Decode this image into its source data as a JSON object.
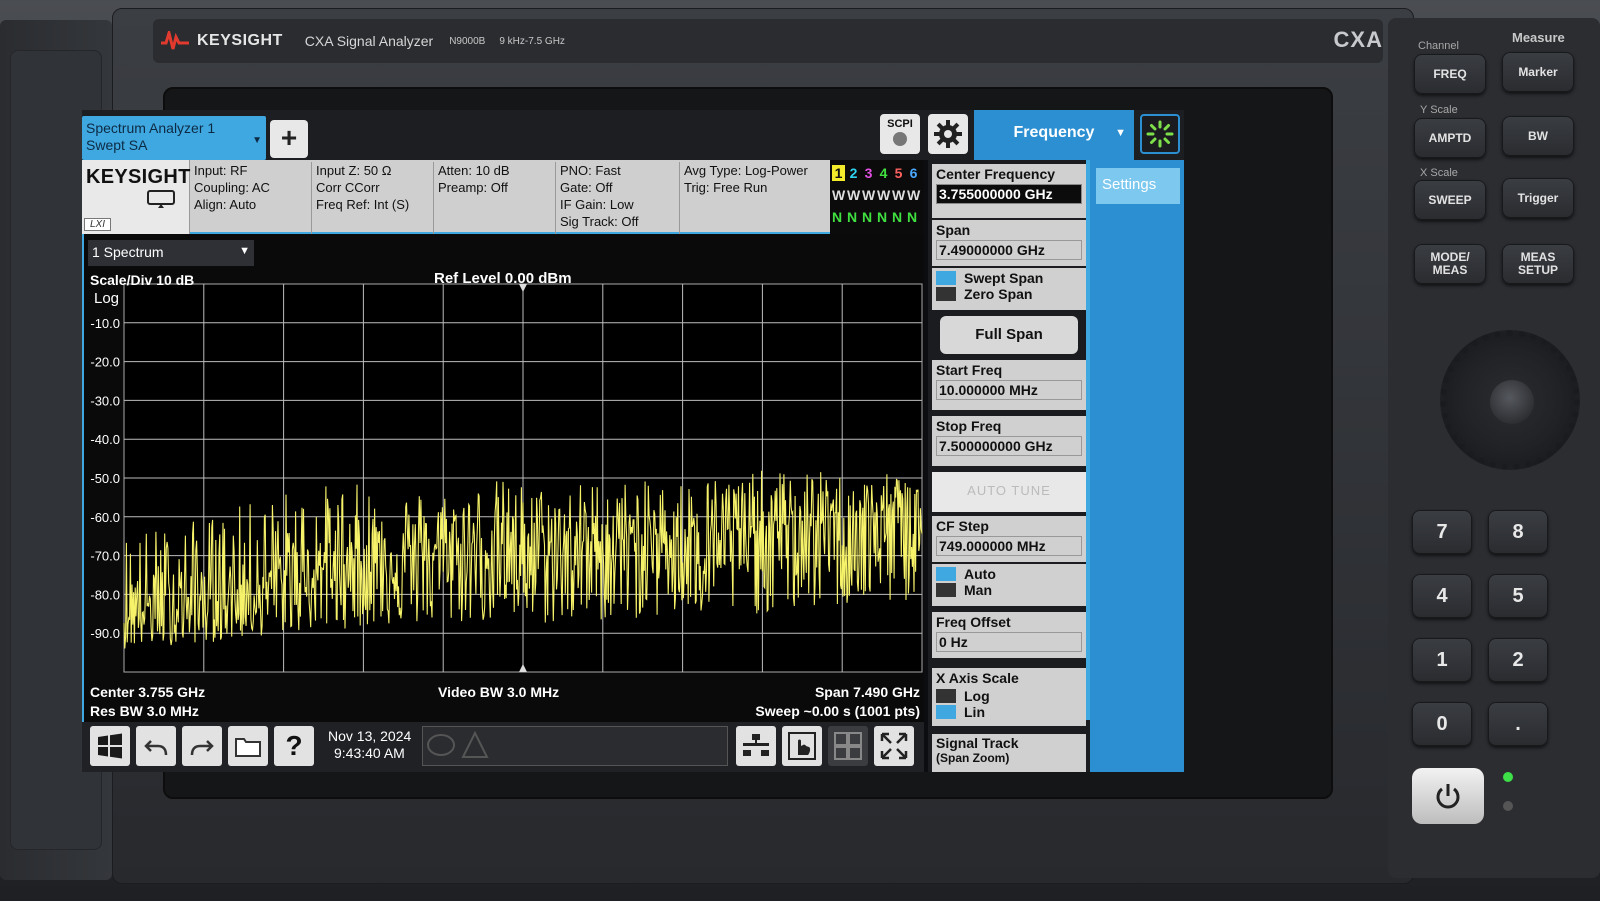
{
  "chassis": {
    "brand": "KEYSIGHT",
    "model_name": "CXA Signal Analyzer",
    "model_no": "N9000B",
    "range": "9 kHz-7.5 GHz",
    "badge": "CXA"
  },
  "topbar": {
    "mode_line1": "Spectrum Analyzer 1",
    "mode_line2": "Swept SA",
    "add_label": "+",
    "scpi_label": "SCPI",
    "menu_tab": "Frequency"
  },
  "infobar": {
    "logo": "KEYSIGHT",
    "lxi": "LXI",
    "col1": [
      "Input: RF",
      "Coupling: AC",
      "Align: Auto"
    ],
    "col2": [
      "Input Z: 50 Ω",
      "Corr CCorr",
      "Freq Ref: Int (S)"
    ],
    "col3": [
      "Atten: 10 dB",
      "Preamp: Off"
    ],
    "col4": [
      "PNO: Fast",
      "Gate: Off",
      "IF Gain: Low",
      "Sig Track: Off"
    ],
    "col5": [
      "Avg Type: Log-Power",
      "Trig: Free Run"
    ],
    "trace_numbers": [
      "1",
      "2",
      "3",
      "4",
      "5",
      "6"
    ],
    "trace_colors": [
      "#f4ec2a",
      "#2fd0f0",
      "#e050e0",
      "#40e040",
      "#ff6060",
      "#4aa8ff"
    ],
    "trace_types": [
      "W",
      "W",
      "W",
      "W",
      "W",
      "W"
    ],
    "trace_det": [
      "N",
      "N",
      "N",
      "N",
      "N",
      "N"
    ]
  },
  "graph": {
    "view": "1 Spectrum",
    "scale_div": "Scale/Div 10 dB",
    "scale_type": "Log",
    "ref_level": "Ref Level 0.00 dBm",
    "center": "Center 3.755 GHz",
    "res_bw": "Res BW 3.0 MHz",
    "video_bw": "Video BW 3.0 MHz",
    "span": "Span 7.490 GHz",
    "sweep": "Sweep ~0.00 s (1001 pts)"
  },
  "toolbar": {
    "date": "Nov 13, 2024",
    "time": "9:43:40 AM"
  },
  "menu": {
    "center_freq_label": "Center Frequency",
    "center_freq_value": "3.755000000 GHz",
    "span_label": "Span",
    "span_value": "7.49000000 GHz",
    "swept_span": "Swept Span",
    "zero_span": "Zero Span",
    "full_span": "Full Span",
    "start_freq_label": "Start Freq",
    "start_freq_value": "10.000000 MHz",
    "stop_freq_label": "Stop Freq",
    "stop_freq_value": "7.500000000 GHz",
    "auto_tune": "AUTO TUNE",
    "cf_step_label": "CF Step",
    "cf_step_value": "749.000000 MHz",
    "auto": "Auto",
    "man": "Man",
    "freq_offset_label": "Freq Offset",
    "freq_offset_value": "0 Hz",
    "x_axis_scale_label": "X Axis Scale",
    "log": "Log",
    "lin": "Lin",
    "signal_track_label": "Signal Track",
    "signal_track_sub": "(Span Zoom)",
    "settings_tab": "Settings"
  },
  "front_panel": {
    "channel_label": "Channel",
    "measure_label": "Measure",
    "y_scale_label": "Y Scale",
    "x_scale_label": "X Scale",
    "freq": "FREQ",
    "marker": "Marker",
    "amptd": "AMPTD",
    "bw": "BW",
    "sweep": "SWEEP",
    "trigger": "Trigger",
    "mode_meas": "MODE/ MEAS",
    "meas_setup": "MEAS SETUP",
    "keys": [
      "7",
      "8",
      "4",
      "5",
      "1",
      "2",
      "0",
      "."
    ]
  },
  "chart_data": {
    "type": "line",
    "ylabel": "Log",
    "ylim": [
      -100,
      0
    ],
    "y_ticks": [
      "-10.0",
      "-20.0",
      "-30.0",
      "-40.0",
      "-50.0",
      "-60.0",
      "-70.0",
      "-80.0",
      "-90.0"
    ],
    "x_range_ghz": [
      0.01,
      7.5
    ],
    "series": [
      {
        "trace_color": "#f6f26a",
        "x_ghz": [
          0.01,
          0.5,
          1.0,
          1.5,
          2.0,
          2.5,
          3.0,
          3.5,
          4.0,
          4.5,
          5.0,
          5.5,
          6.0,
          6.5,
          7.0,
          7.5
        ],
        "noise_floor_dbm": [
          -84,
          -82,
          -80,
          -76,
          -72,
          -70,
          -68,
          -67,
          -68,
          -66,
          -65,
          -64,
          -63,
          -61,
          -60,
          -58
        ],
        "peak_dbm": [
          -63,
          -62,
          -58,
          -53,
          -51,
          -52,
          -53,
          -50,
          -52,
          -50,
          -51,
          -49,
          -48,
          -48,
          -50,
          -47
        ],
        "trough_dbm": [
          -94,
          -93,
          -92,
          -90,
          -89,
          -88,
          -88,
          -87,
          -88,
          -87,
          -86,
          -86,
          -85,
          -84,
          -83,
          -82
        ]
      }
    ]
  }
}
